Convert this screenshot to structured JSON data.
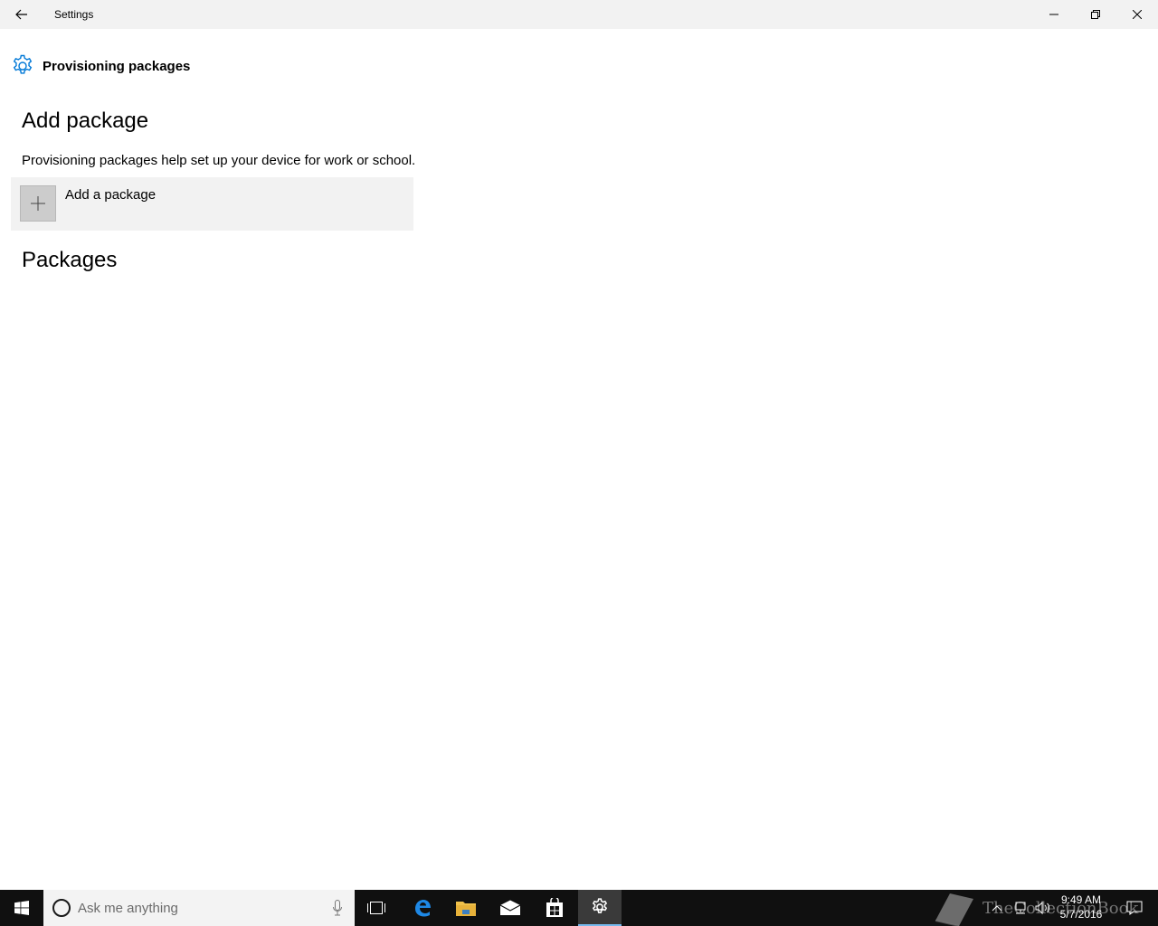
{
  "window": {
    "title": "Settings",
    "back_icon": "back-arrow-icon",
    "minimize_icon": "minimize-icon",
    "restore_icon": "restore-icon",
    "close_icon": "close-icon"
  },
  "page": {
    "icon": "gear-icon",
    "title": "Provisioning packages",
    "accent_color": "#0078d7"
  },
  "add_section": {
    "heading": "Add package",
    "description": "Provisioning packages help set up your device for work or school.",
    "add_button_label": "Add a package",
    "add_button_icon": "plus-icon"
  },
  "packages_section": {
    "heading": "Packages"
  },
  "taskbar": {
    "start_icon": "windows-logo-icon",
    "search_placeholder": "Ask me anything",
    "apps": [
      "task-view-icon",
      "edge-icon",
      "file-explorer-icon",
      "mail-icon",
      "store-icon",
      "settings-icon"
    ],
    "active_app": "settings-icon",
    "clock_time": "9:49 AM",
    "clock_date": "5/7/2016",
    "watermark": "TheCollectionBook"
  }
}
